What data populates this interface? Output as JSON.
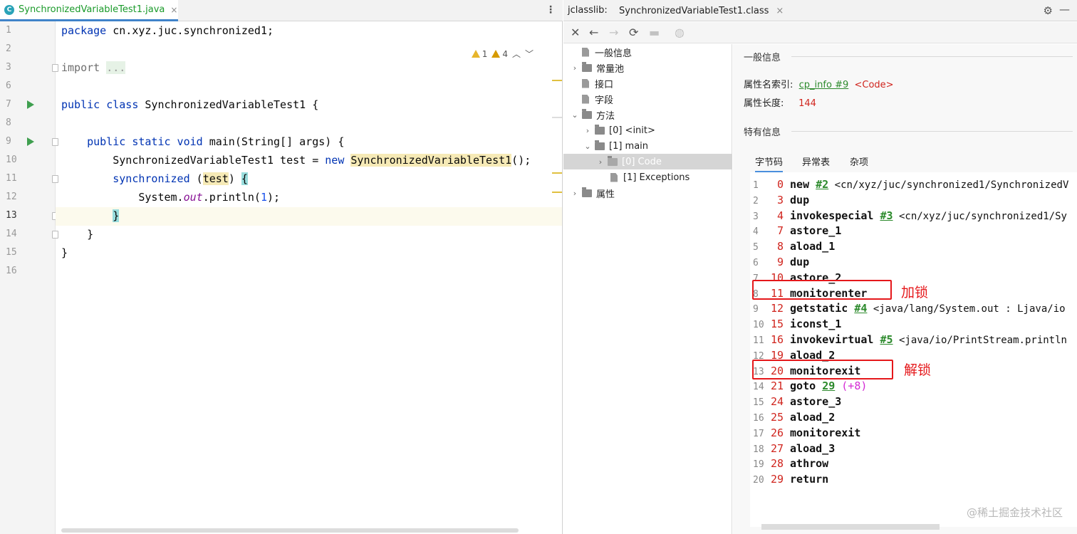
{
  "editor": {
    "tab_icon": "C",
    "tab_title": "SynchronizedVariableTest1.java",
    "tab_close": "×",
    "menu_icon": "⋮",
    "warnings": {
      "count_a": "1",
      "count_b": "4"
    },
    "line_numbers": [
      "1",
      "2",
      "3",
      "6",
      "7",
      "8",
      "9",
      "10",
      "11",
      "12",
      "13",
      "14",
      "15",
      "16"
    ],
    "code": {
      "l1_kw": "package",
      "l1_rest": " cn.xyz.juc.synchronized1;",
      "l3_kw": "import",
      "l3_fold": "...",
      "l7_kw": "public class",
      "l7_rest": " SynchronizedVariableTest1 {",
      "l9_kw": "public static void",
      "l9_rest": " main(String[] args) {",
      "l10_a": "SynchronizedVariableTest1 test = ",
      "l10_kw": "new",
      "l10_hl": "SynchronizedVariableTest1",
      "l10_end": "();",
      "l11_kw": "synchronized",
      "l11_p": " (",
      "l11_hl": "test",
      "l11_c": ") ",
      "l11_brace": "{",
      "l12_a": "System.",
      "l12_it": "out",
      "l12_b": ".println(",
      "l12_num": "1",
      "l12_c": ");",
      "l13_brace": "}",
      "l14": "}",
      "l15": "}"
    }
  },
  "jclasslib": {
    "label": "jclasslib:",
    "tab_title": "SynchronizedVariableTest1.class",
    "tab_close": "×",
    "tree": [
      {
        "label": "一般信息"
      },
      {
        "label": "常量池"
      },
      {
        "label": "接口"
      },
      {
        "label": "字段"
      },
      {
        "label": "方法"
      },
      {
        "label": "[0] <init>"
      },
      {
        "label": "[1] main"
      },
      {
        "label": "[0] Code"
      },
      {
        "label": "[1] Exceptions"
      },
      {
        "label": "属性"
      }
    ],
    "detail": {
      "general_title": "一般信息",
      "name_index_label": "属性名索引:",
      "name_index_link": "cp_info #9",
      "name_index_value": "<Code>",
      "length_label": "属性长度:",
      "length_value": "144",
      "specific_title": "特有信息",
      "tabs": [
        "字节码",
        "异常表",
        "杂项"
      ]
    },
    "bytecode": [
      {
        "ln": "1",
        "off": "0",
        "op": "new",
        "ref": "#2",
        "arg": " <cn/xyz/juc/synchronized1/SynchronizedV"
      },
      {
        "ln": "2",
        "off": "3",
        "op": "dup",
        "ref": "",
        "arg": ""
      },
      {
        "ln": "3",
        "off": "4",
        "op": "invokespecial",
        "ref": "#3",
        "arg": " <cn/xyz/juc/synchronized1/Sy"
      },
      {
        "ln": "4",
        "off": "7",
        "op": "astore_1",
        "ref": "",
        "arg": ""
      },
      {
        "ln": "5",
        "off": "8",
        "op": "aload_1",
        "ref": "",
        "arg": ""
      },
      {
        "ln": "6",
        "off": "9",
        "op": "dup",
        "ref": "",
        "arg": ""
      },
      {
        "ln": "7",
        "off": "10",
        "op": "astore_2",
        "ref": "",
        "arg": ""
      },
      {
        "ln": "8",
        "off": "11",
        "op": "monitorenter",
        "ref": "",
        "arg": ""
      },
      {
        "ln": "9",
        "off": "12",
        "op": "getstatic",
        "ref": "#4",
        "arg": " <java/lang/System.out : Ljava/io"
      },
      {
        "ln": "10",
        "off": "15",
        "op": "iconst_1",
        "ref": "",
        "arg": ""
      },
      {
        "ln": "11",
        "off": "16",
        "op": "invokevirtual",
        "ref": "#5",
        "arg": " <java/io/PrintStream.println"
      },
      {
        "ln": "12",
        "off": "19",
        "op": "aload_2",
        "ref": "",
        "arg": ""
      },
      {
        "ln": "13",
        "off": "20",
        "op": "monitorexit",
        "ref": "",
        "arg": ""
      },
      {
        "ln": "14",
        "off": "21",
        "op": "goto",
        "ref": "29",
        "arg": " (+8)"
      },
      {
        "ln": "15",
        "off": "24",
        "op": "astore_3",
        "ref": "",
        "arg": ""
      },
      {
        "ln": "16",
        "off": "25",
        "op": "aload_2",
        "ref": "",
        "arg": ""
      },
      {
        "ln": "17",
        "off": "26",
        "op": "monitorexit",
        "ref": "",
        "arg": ""
      },
      {
        "ln": "18",
        "off": "27",
        "op": "aload_3",
        "ref": "",
        "arg": ""
      },
      {
        "ln": "19",
        "off": "28",
        "op": "athrow",
        "ref": "",
        "arg": ""
      },
      {
        "ln": "20",
        "off": "29",
        "op": "return",
        "ref": "",
        "arg": ""
      }
    ],
    "annotations": {
      "lock": "加锁",
      "unlock": "解锁"
    }
  },
  "watermark": "@稀土掘金技术社区",
  "colors": {
    "accent": "#4083c9",
    "annotation_red": "#e5181b",
    "offset_red": "#d0241d",
    "link_green": "#2c8a2c"
  }
}
